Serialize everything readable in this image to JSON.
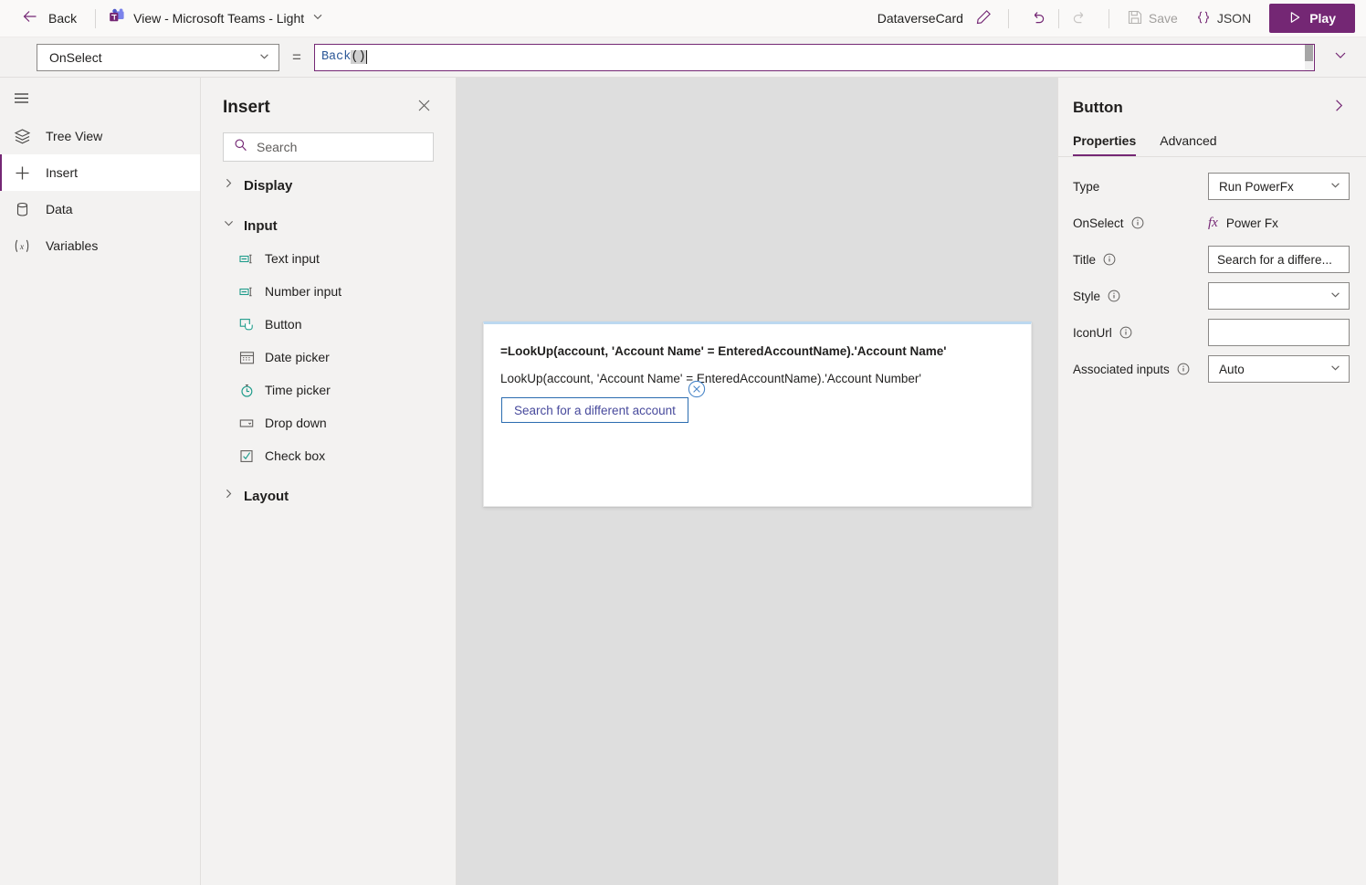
{
  "topbar": {
    "back_label": "Back",
    "back_icon": "arrow-left-icon",
    "app_icon": "microsoft-teams-icon",
    "app_title": "View - Microsoft Teams - Light",
    "app_title_chevron": "chevron-down-icon",
    "card_name": "DataverseCard",
    "edit_icon": "pencil-icon",
    "undo_icon": "undo-icon",
    "redo_icon": "redo-icon",
    "save_icon": "save-icon",
    "save_label": "Save",
    "json_icon": "braces-icon",
    "json_label": "JSON",
    "play_icon": "play-icon",
    "play_label": "Play",
    "accent_color": "#742774",
    "disabled_color": "#a19f9d"
  },
  "formulabar": {
    "property": "OnSelect",
    "property_chevron": "chevron-down-icon",
    "equals": "=",
    "formula_function": "Back",
    "formula_parens": "()",
    "expand_icon": "chevron-down-icon",
    "border_color": "#742774"
  },
  "rail": {
    "menu_icon": "hamburger-menu-icon",
    "items": [
      {
        "label": "Tree View",
        "icon": "layers-icon",
        "active": false
      },
      {
        "label": "Insert",
        "icon": "plus-icon",
        "active": true
      },
      {
        "label": "Data",
        "icon": "database-icon",
        "active": false
      },
      {
        "label": "Variables",
        "icon": "variables-icon",
        "active": false
      }
    ]
  },
  "insert_panel": {
    "title": "Insert",
    "close_icon": "close-icon",
    "search_placeholder": "Search",
    "search_value": "",
    "search_icon": "search-icon",
    "groups": [
      {
        "label": "Display",
        "expanded": false,
        "chevron": "chevron-right-icon",
        "items": []
      },
      {
        "label": "Input",
        "expanded": true,
        "chevron": "chevron-down-icon",
        "items": [
          {
            "label": "Text input",
            "icon": "text-input-icon"
          },
          {
            "label": "Number input",
            "icon": "number-input-icon"
          },
          {
            "label": "Button",
            "icon": "button-icon"
          },
          {
            "label": "Date picker",
            "icon": "calendar-icon"
          },
          {
            "label": "Time picker",
            "icon": "clock-icon"
          },
          {
            "label": "Drop down",
            "icon": "dropdown-icon"
          },
          {
            "label": "Check box",
            "icon": "checkbox-icon"
          }
        ]
      },
      {
        "label": "Layout",
        "expanded": false,
        "chevron": "chevron-right-icon",
        "items": []
      }
    ]
  },
  "canvas": {
    "background_color": "#dedede",
    "card": {
      "accent_bar_color": "#bcd8f0",
      "line1": "=LookUp(account, 'Account Name' = EnteredAccountName).'Account Name'",
      "line2": "LookUp(account, 'Account Name' = EnteredAccountName).'Account Number'",
      "button_label": "Search for a different account",
      "button_border_color": "#2b6cb0",
      "delete_icon": "circle-close-icon"
    }
  },
  "properties_panel": {
    "title": "Button",
    "collapse_icon": "chevron-right-icon",
    "tabs": [
      {
        "label": "Properties",
        "active": true
      },
      {
        "label": "Advanced",
        "active": false
      }
    ],
    "fields": [
      {
        "label": "Type",
        "info": false,
        "control": "select",
        "value": "Run PowerFx",
        "chevron": "chevron-down-icon"
      },
      {
        "label": "OnSelect",
        "info": true,
        "control": "fx",
        "value": "Power Fx",
        "icon": "fx-icon"
      },
      {
        "label": "Title",
        "info": true,
        "control": "text",
        "value": "Search for a differe..."
      },
      {
        "label": "Style",
        "info": true,
        "control": "select",
        "value": "",
        "chevron": "chevron-down-icon"
      },
      {
        "label": "IconUrl",
        "info": true,
        "control": "text",
        "value": ""
      },
      {
        "label": "Associated inputs",
        "info": true,
        "control": "select",
        "value": "Auto",
        "chevron": "chevron-down-icon"
      }
    ]
  }
}
